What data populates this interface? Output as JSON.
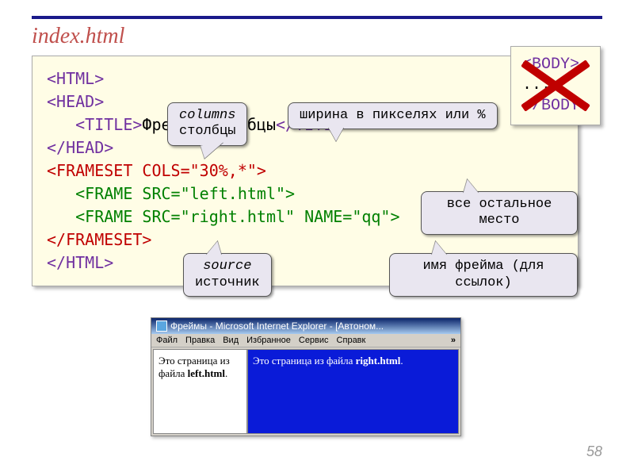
{
  "title": "index.html",
  "code": {
    "l1a": "<HTML>",
    "l2a": "<HEAD>",
    "l3a": "   <TITLE>",
    "l3b": "Фреймы-столбцы",
    "l3c": "</TITLE>",
    "l4a": "</HEAD>",
    "l5a": "<FRAMESET COLS=\"",
    "l5b": "30%",
    "l5c": ",",
    "l5d": "*",
    "l5e": "\">",
    "l6a": "   <FRAME SRC=\"left.html\">",
    "l7a": "   <FRAME SRC=\"right.html\" NAME=\"qq\">",
    "l8a": "</FRAMESET>",
    "l9a": "</HTML>"
  },
  "callouts": {
    "columns_line1": "columns",
    "columns_line2": "столбцы",
    "width": "ширина в пикселях или %",
    "rest": "все остальное место",
    "source_line1": "source",
    "source_line2": "источник",
    "name": "имя фрейма (для ссылок)"
  },
  "bodyx": {
    "open": "<BODY>",
    "dots": "...",
    "close": "</BODY>"
  },
  "browser": {
    "title": "Фреймы - Microsoft Internet Explorer - [Автоном...",
    "menu": {
      "file": "Файл",
      "edit": "Правка",
      "view": "Вид",
      "fav": "Избранное",
      "serv": "Сервис",
      "help": "Справк"
    },
    "left_text": "Это страница из файла",
    "left_bold": "left.html",
    "right_text": "Это страница из файла",
    "right_bold": "right.html",
    "period": "."
  },
  "page_number": "58"
}
